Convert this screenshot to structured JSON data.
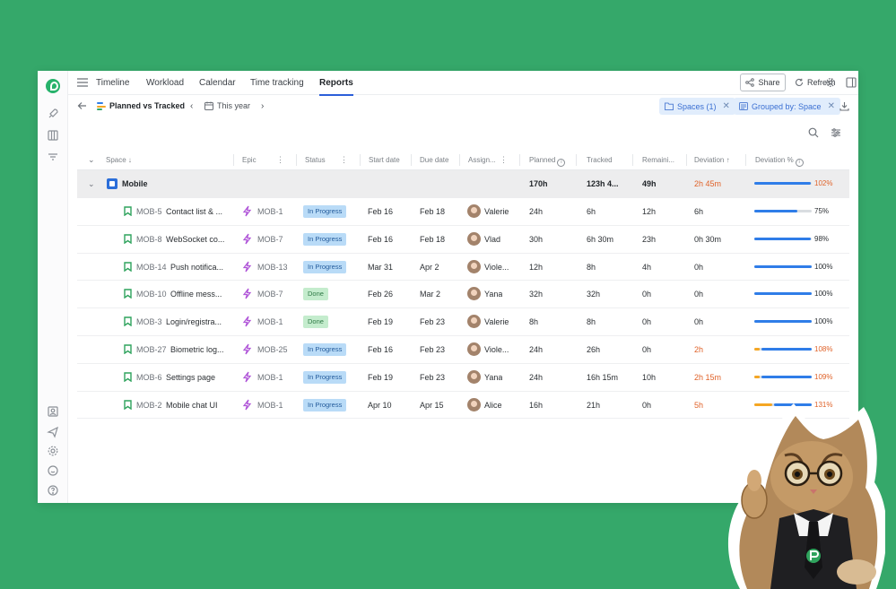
{
  "app": {
    "nav_tabs": [
      "Timeline",
      "Workload",
      "Calendar",
      "Time tracking",
      "Reports"
    ],
    "active_tab": "Reports",
    "share_label": "Share",
    "refresh_label": "Refresh"
  },
  "report": {
    "title": "Planned vs Tracked",
    "period": "This year",
    "filter_spaces": "Spaces (1)",
    "filter_grouped": "Grouped by: Space"
  },
  "columns": {
    "space": "Space ↓",
    "epic": "Epic",
    "status": "Status",
    "start": "Start date",
    "due": "Due date",
    "assignee": "Assign...",
    "planned": "Planned",
    "tracked": "Tracked",
    "remaining": "Remaini...",
    "deviation": "Deviation ↑",
    "deviation_pct": "Deviation %"
  },
  "group": {
    "name": "Mobile",
    "planned": "170h",
    "tracked": "123h 4...",
    "remaining": "49h",
    "deviation": "2h 45m",
    "deviation_pct": "102%",
    "progress": 0.98
  },
  "rows": [
    {
      "key": "MOB-5",
      "title": "Contact list & ...",
      "epic": "MOB-1",
      "status": "In Progress",
      "start": "Feb 16",
      "due": "Feb 18",
      "assignee": "Valerie",
      "planned": "24h",
      "tracked": "6h",
      "remaining": "12h",
      "deviation": "6h",
      "deviation_pct": "75%",
      "progress": 0.75,
      "over": 0
    },
    {
      "key": "MOB-8",
      "title": "WebSocket co...",
      "epic": "MOB-7",
      "status": "In Progress",
      "start": "Feb 16",
      "due": "Feb 18",
      "assignee": "Vlad",
      "planned": "30h",
      "tracked": "6h 30m",
      "remaining": "23h",
      "deviation": "0h 30m",
      "deviation_pct": "98%",
      "progress": 0.98,
      "over": 0
    },
    {
      "key": "MOB-14",
      "title": "Push notifica...",
      "epic": "MOB-13",
      "status": "In Progress",
      "start": "Mar 31",
      "due": "Apr 2",
      "assignee": "Viole...",
      "planned": "12h",
      "tracked": "8h",
      "remaining": "4h",
      "deviation": "0h",
      "deviation_pct": "100%",
      "progress": 1.0,
      "over": 0
    },
    {
      "key": "MOB-10",
      "title": "Offline mess...",
      "epic": "MOB-7",
      "status": "Done",
      "start": "Feb 26",
      "due": "Mar 2",
      "assignee": "Yana",
      "planned": "32h",
      "tracked": "32h",
      "remaining": "0h",
      "deviation": "0h",
      "deviation_pct": "100%",
      "progress": 1.0,
      "over": 0
    },
    {
      "key": "MOB-3",
      "title": "Login/registra...",
      "epic": "MOB-1",
      "status": "Done",
      "start": "Feb 19",
      "due": "Feb 23",
      "assignee": "Valerie",
      "planned": "8h",
      "tracked": "8h",
      "remaining": "0h",
      "deviation": "0h",
      "deviation_pct": "100%",
      "progress": 1.0,
      "over": 0
    },
    {
      "key": "MOB-27",
      "title": "Biometric log...",
      "epic": "MOB-25",
      "status": "In Progress",
      "start": "Feb 16",
      "due": "Feb 23",
      "assignee": "Viole...",
      "planned": "24h",
      "tracked": "26h",
      "remaining": "0h",
      "deviation": "2h",
      "deviation_pct": "108%",
      "progress": 1.0,
      "over": 0.08
    },
    {
      "key": "MOB-6",
      "title": "Settings page",
      "epic": "MOB-1",
      "status": "In Progress",
      "start": "Feb 19",
      "due": "Feb 23",
      "assignee": "Yana",
      "planned": "24h",
      "tracked": "16h 15m",
      "remaining": "10h",
      "deviation": "2h 15m",
      "deviation_pct": "109%",
      "progress": 1.0,
      "over": 0.09
    },
    {
      "key": "MOB-2",
      "title": "Mobile chat UI",
      "epic": "MOB-1",
      "status": "In Progress",
      "start": "Apr 10",
      "due": "Apr 15",
      "assignee": "Alice",
      "planned": "16h",
      "tracked": "21h",
      "remaining": "0h",
      "deviation": "5h",
      "deviation_pct": "131%",
      "progress": 1.0,
      "over": 0.31
    }
  ],
  "colors": {
    "background": "#35a86a",
    "accent": "#2b5fd9",
    "bar_fill": "#2f7de8",
    "bar_over": "#f5a623",
    "deviation_red": "#e0632a",
    "in_progress_bg": "#b9dbf7",
    "done_bg": "#c4eccd"
  }
}
